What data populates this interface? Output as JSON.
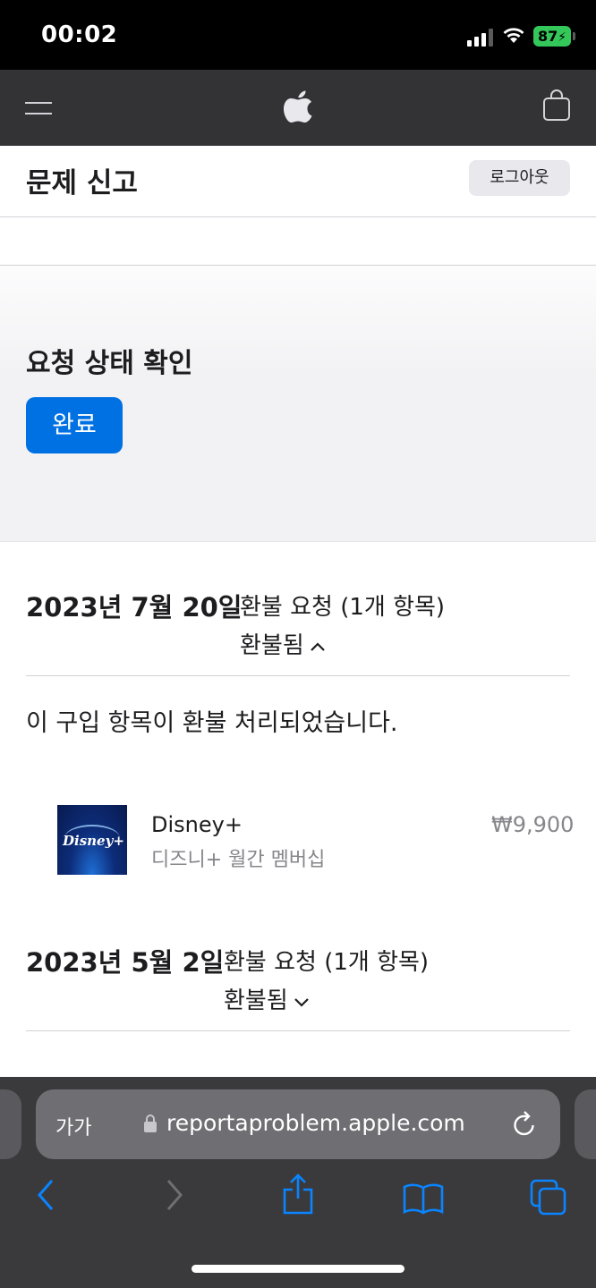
{
  "status_bar": {
    "time": "00:02",
    "battery": "87",
    "icons": [
      "cellular-signal-icon",
      "wifi-icon",
      "battery-charging-icon"
    ]
  },
  "apple_nav": {
    "icons": [
      "menu-icon",
      "apple-logo-icon",
      "shopping-bag-icon"
    ]
  },
  "header": {
    "title": "문제 신고",
    "signout_label": "로그아웃"
  },
  "status_section": {
    "heading": "요청 상태 확인",
    "done_label": "완료"
  },
  "requests": [
    {
      "date": "2023년 7월 20일",
      "type": "환불 요청 (1개 항목)",
      "status": "환불됨",
      "expanded": true,
      "message": "이 구입 항목이 환불 처리되었습니다.",
      "items": [
        {
          "thumb_text": "Disney+",
          "name": "Disney+",
          "description": "디즈니+ 월간 멤버십",
          "price": "₩9,900"
        }
      ]
    },
    {
      "date": "2023년 5월 2일",
      "type": "환불 요청 (1개 항목)",
      "status": "환불됨",
      "expanded": false
    }
  ],
  "safari": {
    "text_size_label": "가가",
    "url": "reportaproblem.apple.com",
    "toolbar_icons": [
      "back-icon",
      "forward-icon",
      "share-icon",
      "bookmarks-icon",
      "tabs-icon"
    ]
  },
  "colors": {
    "accent": "#0071e3",
    "nav_bg": "#333336",
    "battery": "#34c759",
    "secondary_text": "#86868b"
  }
}
